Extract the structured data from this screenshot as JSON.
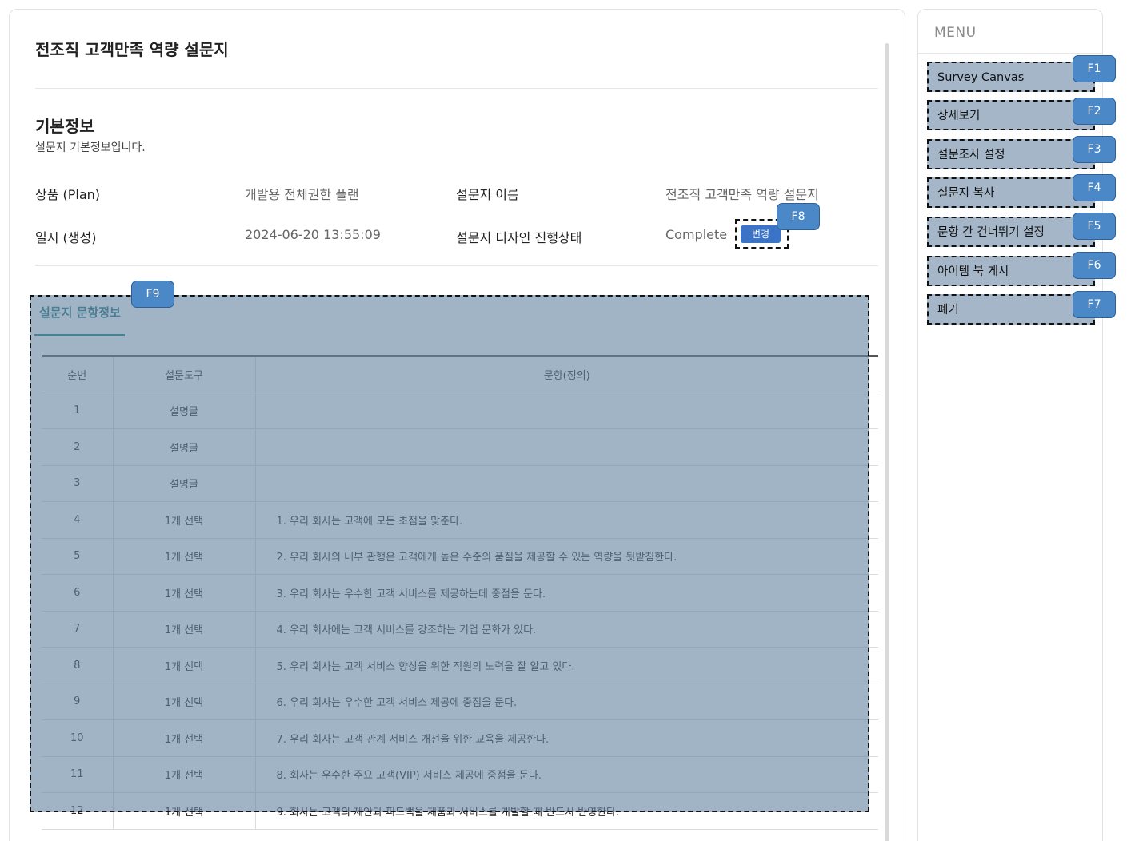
{
  "survey": {
    "title": "전조직 고객만족 역량 설문지",
    "section_title": "기본정보",
    "section_subtitle": "설문지 기본정보입니다.",
    "fields": {
      "plan_label": "상품 (Plan)",
      "plan_value": "개발용 전체권한 플랜",
      "name_label": "설문지 이름",
      "name_value": "전조직 고객만족 역량 설문지",
      "date_label": "일시 (생성)",
      "date_value": "2024-06-20 13:55:09",
      "status_label": "설문지 디자인 진행상태",
      "status_value": "Complete",
      "change_button": "변경"
    }
  },
  "tabs": {
    "active": "설문지 문항정보"
  },
  "table": {
    "headers": [
      "순번",
      "설문도구",
      "문항(정의)"
    ],
    "rows": [
      {
        "no": "1",
        "tool": "설명글",
        "question": ""
      },
      {
        "no": "2",
        "tool": "설명글",
        "question": ""
      },
      {
        "no": "3",
        "tool": "설명글",
        "question": ""
      },
      {
        "no": "4",
        "tool": "1개 선택",
        "question": "1. 우리 회사는 고객에 모든 초점을 맞춘다."
      },
      {
        "no": "5",
        "tool": "1개 선택",
        "question": "2. 우리 회사의 내부 관행은 고객에게 높은 수준의 품질을 제공할 수 있는 역량을 뒷받침한다."
      },
      {
        "no": "6",
        "tool": "1개 선택",
        "question": "3. 우리 회사는 우수한 고객 서비스를 제공하는데 중점을 둔다."
      },
      {
        "no": "7",
        "tool": "1개 선택",
        "question": "4. 우리 회사에는 고객 서비스를 강조하는 기업 문화가 있다."
      },
      {
        "no": "8",
        "tool": "1개 선택",
        "question": "5. 우리 회사는 고객 서비스 향상을 위한 직원의 노력을 잘 알고 있다."
      },
      {
        "no": "9",
        "tool": "1개 선택",
        "question": "6. 우리 회사는 우수한 고객 서비스 제공에 중점을 둔다."
      },
      {
        "no": "10",
        "tool": "1개 선택",
        "question": "7. 우리 회사는 고객 관계 서비스 개선을 위한 교육을 제공한다."
      },
      {
        "no": "11",
        "tool": "1개 선택",
        "question": "8. 회사는 우수한 주요 고객(VIP) 서비스 제공에 중점을 둔다."
      },
      {
        "no": "12",
        "tool": "1개 선택",
        "question": "9. 회사는 고객의 제안과 피드백을 제품과 서비스를 개발할 때 반드시 반영한다."
      }
    ]
  },
  "menu": {
    "title": "MENU",
    "items": [
      {
        "label": "Survey Canvas",
        "key": "F1"
      },
      {
        "label": "상세보기",
        "key": "F2"
      },
      {
        "label": "설문조사 설정",
        "key": "F3"
      },
      {
        "label": "설문지 복사",
        "key": "F4"
      },
      {
        "label": "문항 간 건너뛰기 설정",
        "key": "F5"
      },
      {
        "label": "아이템 북 게시",
        "key": "F6"
      },
      {
        "label": "폐기",
        "key": "F7"
      }
    ]
  },
  "badges": {
    "change_button_key": "F8",
    "table_region_key": "F9"
  },
  "colors": {
    "accent": "#3b73c7",
    "tab_active": "#1f6e78",
    "overlay": "#6886a3",
    "badge": "#4a88c8"
  }
}
